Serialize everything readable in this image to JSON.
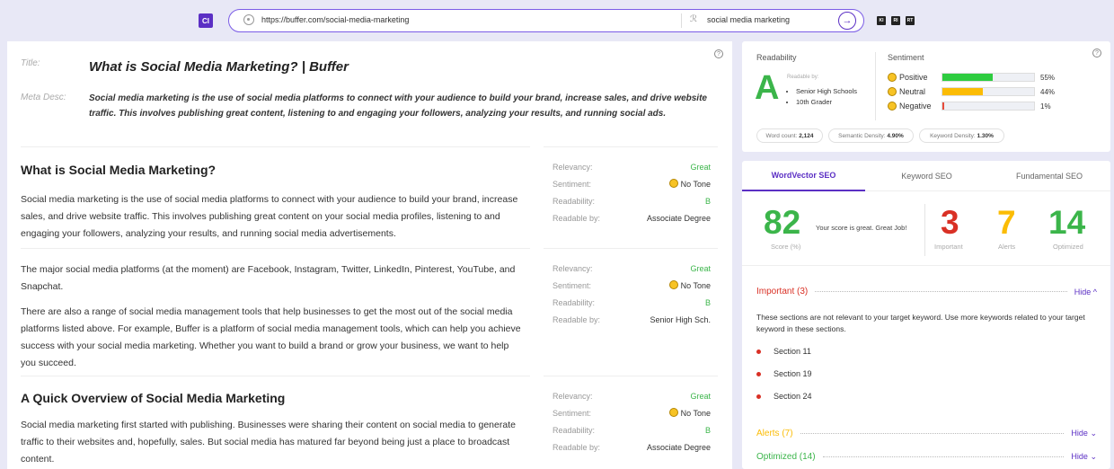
{
  "topbar": {
    "logo": "CI",
    "url": "https://buffer.com/social-media-marketing",
    "keyword": "social media marketing",
    "buttons": [
      "KI",
      "RI",
      "RT"
    ]
  },
  "meta": {
    "title_label": "Title:",
    "title": "What is Social Media Marketing? | Buffer",
    "desc_label": "Meta Desc:",
    "desc": "Social media marketing is the use of social media platforms to connect with your audience to build your brand, increase sales, and drive website traffic. This involves publishing great content, listening to and engaging your followers, analyzing your results, and running social ads."
  },
  "metric_labels": [
    "Relevancy:",
    "Sentiment:",
    "Readability:",
    "Readable by:"
  ],
  "sections": [
    {
      "heading": "What is Social Media Marketing?",
      "p1": "Social media marketing is the use of social media platforms to connect with your audience to build your brand, increase sales, and drive website traffic. This involves publishing great content on your social media profiles, listening to and engaging your followers, analyzing your results, and running social media advertisements.",
      "relevancy": "Great",
      "sentiment": "No Tone",
      "readability": "B",
      "readable_by": "Associate Degree"
    },
    {
      "p1": "The major social media platforms (at the moment) are Facebook, Instagram, Twitter, LinkedIn, Pinterest, YouTube, and Snapchat.",
      "p2": "There are also a range of social media management tools that help businesses to get the most out of the social media platforms listed above. For example, Buffer is a platform of social media management tools, which can help you achieve success with your social media marketing. Whether you want to build a brand or grow your business, we want to help you succeed.",
      "relevancy": "Great",
      "sentiment": "No Tone",
      "readability": "B",
      "readable_by": "Senior High Sch."
    },
    {
      "heading": "A Quick Overview of Social Media Marketing",
      "p1": "Social media marketing first started with publishing. Businesses were sharing their content on social media to generate traffic to their websites and, hopefully, sales. But social media has matured far beyond being just a place to broadcast content.",
      "relevancy": "Great",
      "sentiment": "No Tone",
      "readability": "B",
      "readable_by": "Associate Degree"
    }
  ],
  "readability": {
    "heading": "Readability",
    "grade": "A",
    "readable_by_label": "Readable by:",
    "levels": [
      "Senior High Schools",
      "10th Grader"
    ]
  },
  "sentiment": {
    "heading": "Sentiment",
    "rows": [
      {
        "label": "Positive",
        "percent": "55%",
        "value": 0.55,
        "color": "#2ecc40"
      },
      {
        "label": "Neutral",
        "percent": "44%",
        "value": 0.44,
        "color": "#fbbc05"
      },
      {
        "label": "Negative",
        "percent": "1%",
        "value": 0.01,
        "color": "#e74c3c"
      }
    ]
  },
  "stats": {
    "word_count_label": "Word count:",
    "word_count": "2,124",
    "semantic_label": "Semantic Density:",
    "semantic": "4.90%",
    "keyword_label": "Keyword Density:",
    "keyword": "1.30%"
  },
  "tabs": [
    "WordVector SEO",
    "Keyword SEO",
    "Fundamental SEO"
  ],
  "score": {
    "value": "82",
    "label": "Score (%)",
    "message": "Your score is great. Great Job!",
    "important": "3",
    "important_label": "Important",
    "alerts": "7",
    "alerts_label": "Alerts",
    "optimized": "14",
    "optimized_label": "Optimized"
  },
  "important": {
    "title": "Important (3)",
    "toggle": "Hide",
    "desc": "These sections are not relevant to your target keyword. Use more keywords related to your target keyword in these sections.",
    "items": [
      "Section 11",
      "Section 19",
      "Section 24"
    ]
  },
  "alerts": {
    "title": "Alerts (7)",
    "toggle": "Hide"
  },
  "optimized": {
    "title": "Optimized (14)",
    "toggle": "Hide"
  },
  "colors": {
    "accent": "#5b2fc4",
    "green": "#3bb54a",
    "red": "#d93025",
    "orange": "#fbbc05"
  }
}
